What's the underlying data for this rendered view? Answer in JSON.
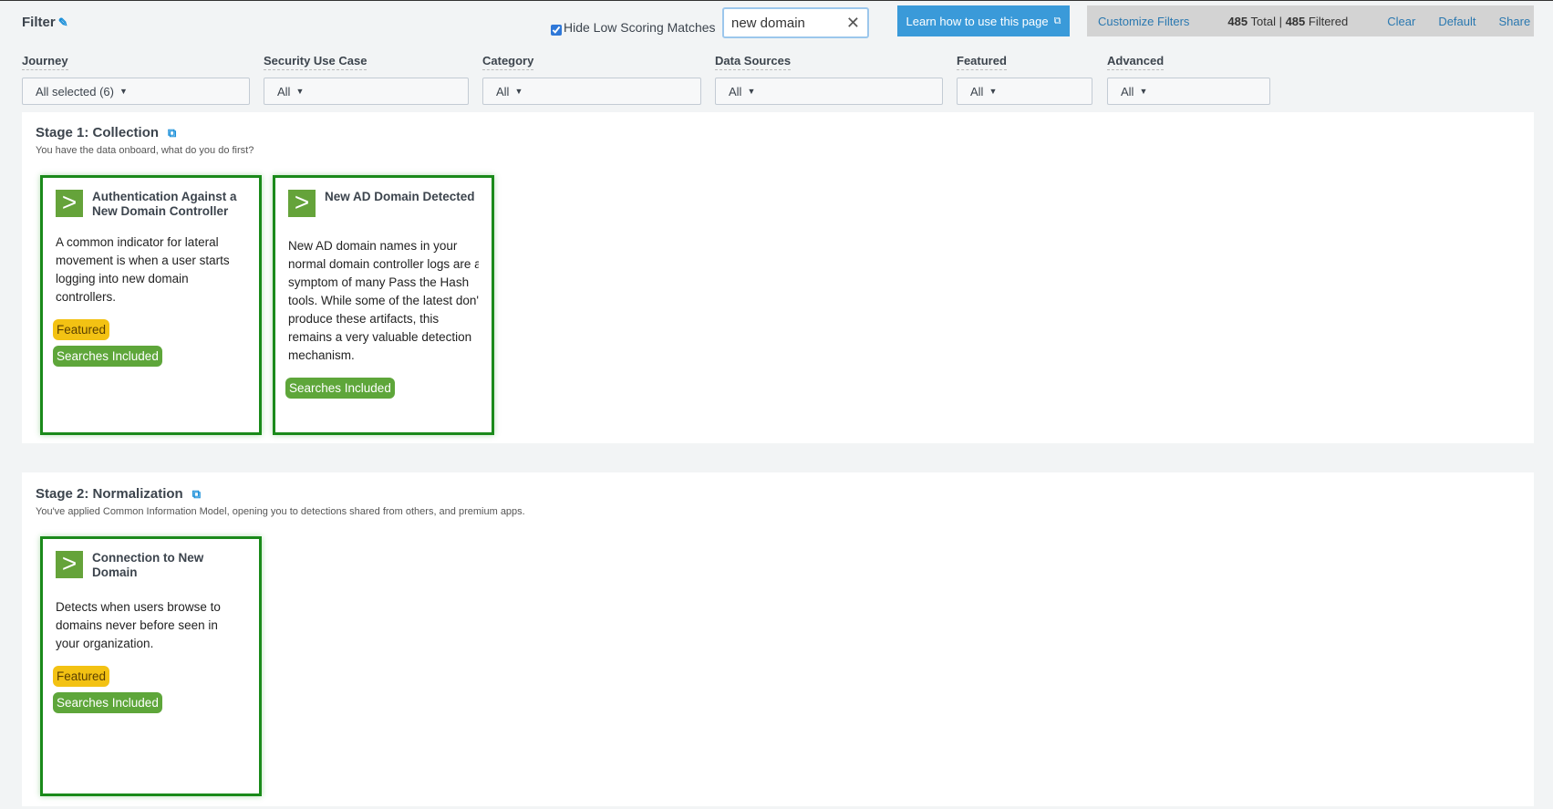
{
  "header": {
    "title": "Filter",
    "hide_low_label": "Hide Low Scoring Matches",
    "hide_low_checked": true,
    "search_value": "new domain",
    "learn_label": "Learn how to use this page",
    "customize_label": "Customize Filters",
    "total_count": "485",
    "total_label": " Total | ",
    "filtered_count": "485",
    "filtered_label": " Filtered",
    "clear_label": "Clear",
    "default_label": "Default",
    "share_label": "Share"
  },
  "filters": [
    {
      "label": "Journey",
      "value": "All selected (6)"
    },
    {
      "label": "Security Use Case",
      "value": "All"
    },
    {
      "label": "Category",
      "value": "All"
    },
    {
      "label": "Data Sources",
      "value": "All"
    },
    {
      "label": "Featured",
      "value": "All"
    },
    {
      "label": "Advanced",
      "value": "All"
    }
  ],
  "stages": [
    {
      "title": "Stage 1: Collection",
      "subtitle": "You have the data onboard, what do you do first?",
      "cards": [
        {
          "title": "Authentication Against a New Domain Controller",
          "desc": [
            "A common indicator for lateral",
            "movement is when a user starts",
            "logging into new domain",
            "controllers."
          ],
          "featured": "Featured",
          "searches": "Searches Included"
        },
        {
          "title": "New AD Domain Detected",
          "desc": [
            "New AD domain names in your",
            "normal domain controller logs are a",
            "symptom of many Pass the Hash",
            "tools. While some of the latest don't",
            "produce these artifacts, this",
            "remains a very valuable detection",
            "mechanism."
          ],
          "searches": "Searches Included"
        }
      ]
    },
    {
      "title": "Stage 2: Normalization",
      "subtitle": "You've applied Common Information Model, opening you to detections shared from others, and premium apps.",
      "cards": [
        {
          "title": "Connection to New Domain",
          "desc": [
            "Detects when users browse to",
            "domains never before seen in",
            "your organization."
          ],
          "featured": "Featured",
          "searches": "Searches Included"
        }
      ]
    }
  ],
  "colors": {
    "accent": "#3a9ad9",
    "card_border": "#1a8a1a",
    "featured": "#f3c213",
    "searches": "#5ea63a"
  }
}
